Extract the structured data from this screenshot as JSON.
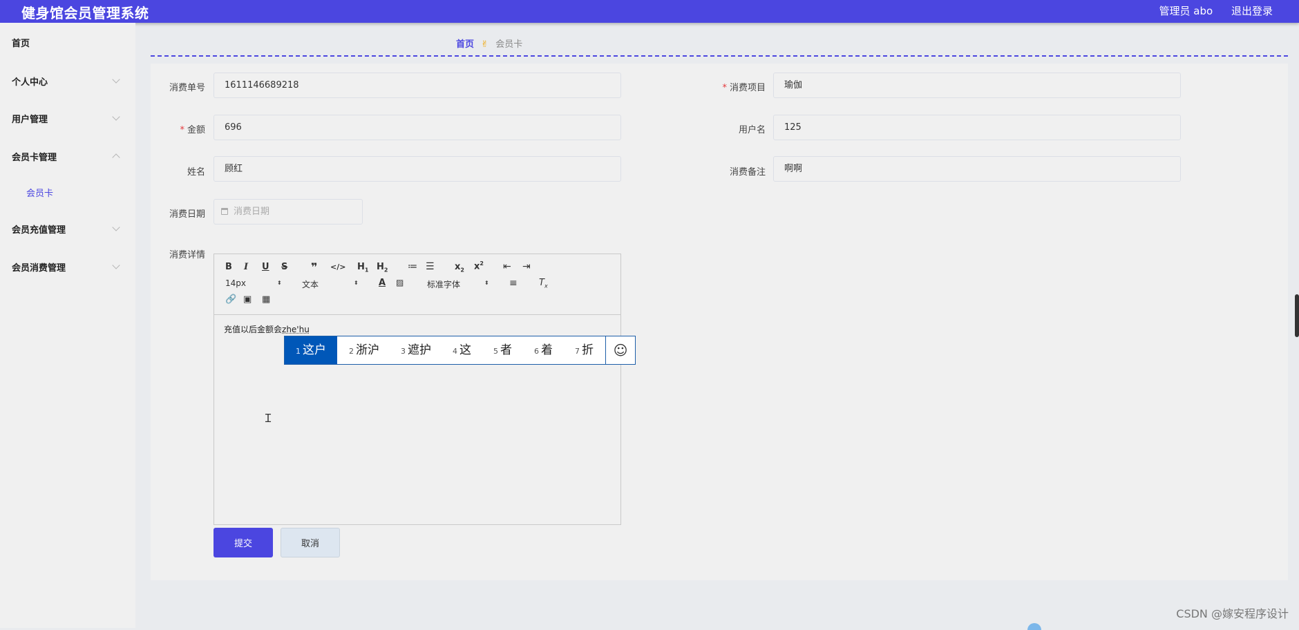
{
  "header": {
    "title": "健身馆会员管理系统",
    "admin": "管理员 abo",
    "logout": "退出登录"
  },
  "sidebar": {
    "items": [
      {
        "label": "首页"
      },
      {
        "label": "个人中心"
      },
      {
        "label": "用户管理"
      },
      {
        "label": "会员卡管理"
      },
      {
        "label": "会员充值管理"
      },
      {
        "label": "会员消费管理"
      }
    ],
    "sub_item": "会员卡"
  },
  "breadcrumb": {
    "home": "首页",
    "separator_icon": "hand-icon",
    "current": "会员卡"
  },
  "form": {
    "order_no": {
      "label": "消费单号",
      "value": "1611146689218"
    },
    "item": {
      "label": "消费项目",
      "value": "瑜伽"
    },
    "amount": {
      "label": "金额",
      "value": "696"
    },
    "username": {
      "label": "用户名",
      "value": "125"
    },
    "name": {
      "label": "姓名",
      "value": "顾红"
    },
    "remark": {
      "label": "消费备注",
      "value": "啊啊"
    },
    "date": {
      "label": "消费日期",
      "placeholder": "消费日期"
    },
    "detail": {
      "label": "消费详情"
    }
  },
  "editor": {
    "font_size": "14px",
    "text_type": "文本",
    "font_family": "标准字体",
    "content": "充值以后金额会",
    "composing": "zhe'hu"
  },
  "ime": {
    "candidates": [
      {
        "num": "1",
        "text": "这户"
      },
      {
        "num": "2",
        "text": "浙沪"
      },
      {
        "num": "3",
        "text": "遮护"
      },
      {
        "num": "4",
        "text": "这"
      },
      {
        "num": "5",
        "text": "者"
      },
      {
        "num": "6",
        "text": "着"
      },
      {
        "num": "7",
        "text": "折"
      }
    ],
    "emoji_glyph": "☺"
  },
  "buttons": {
    "submit": "提交",
    "cancel": "取消"
  },
  "watermark": "CSDN @嫁安程序设计",
  "colors": {
    "primary": "#4b46e0",
    "required": "#e4393c"
  }
}
